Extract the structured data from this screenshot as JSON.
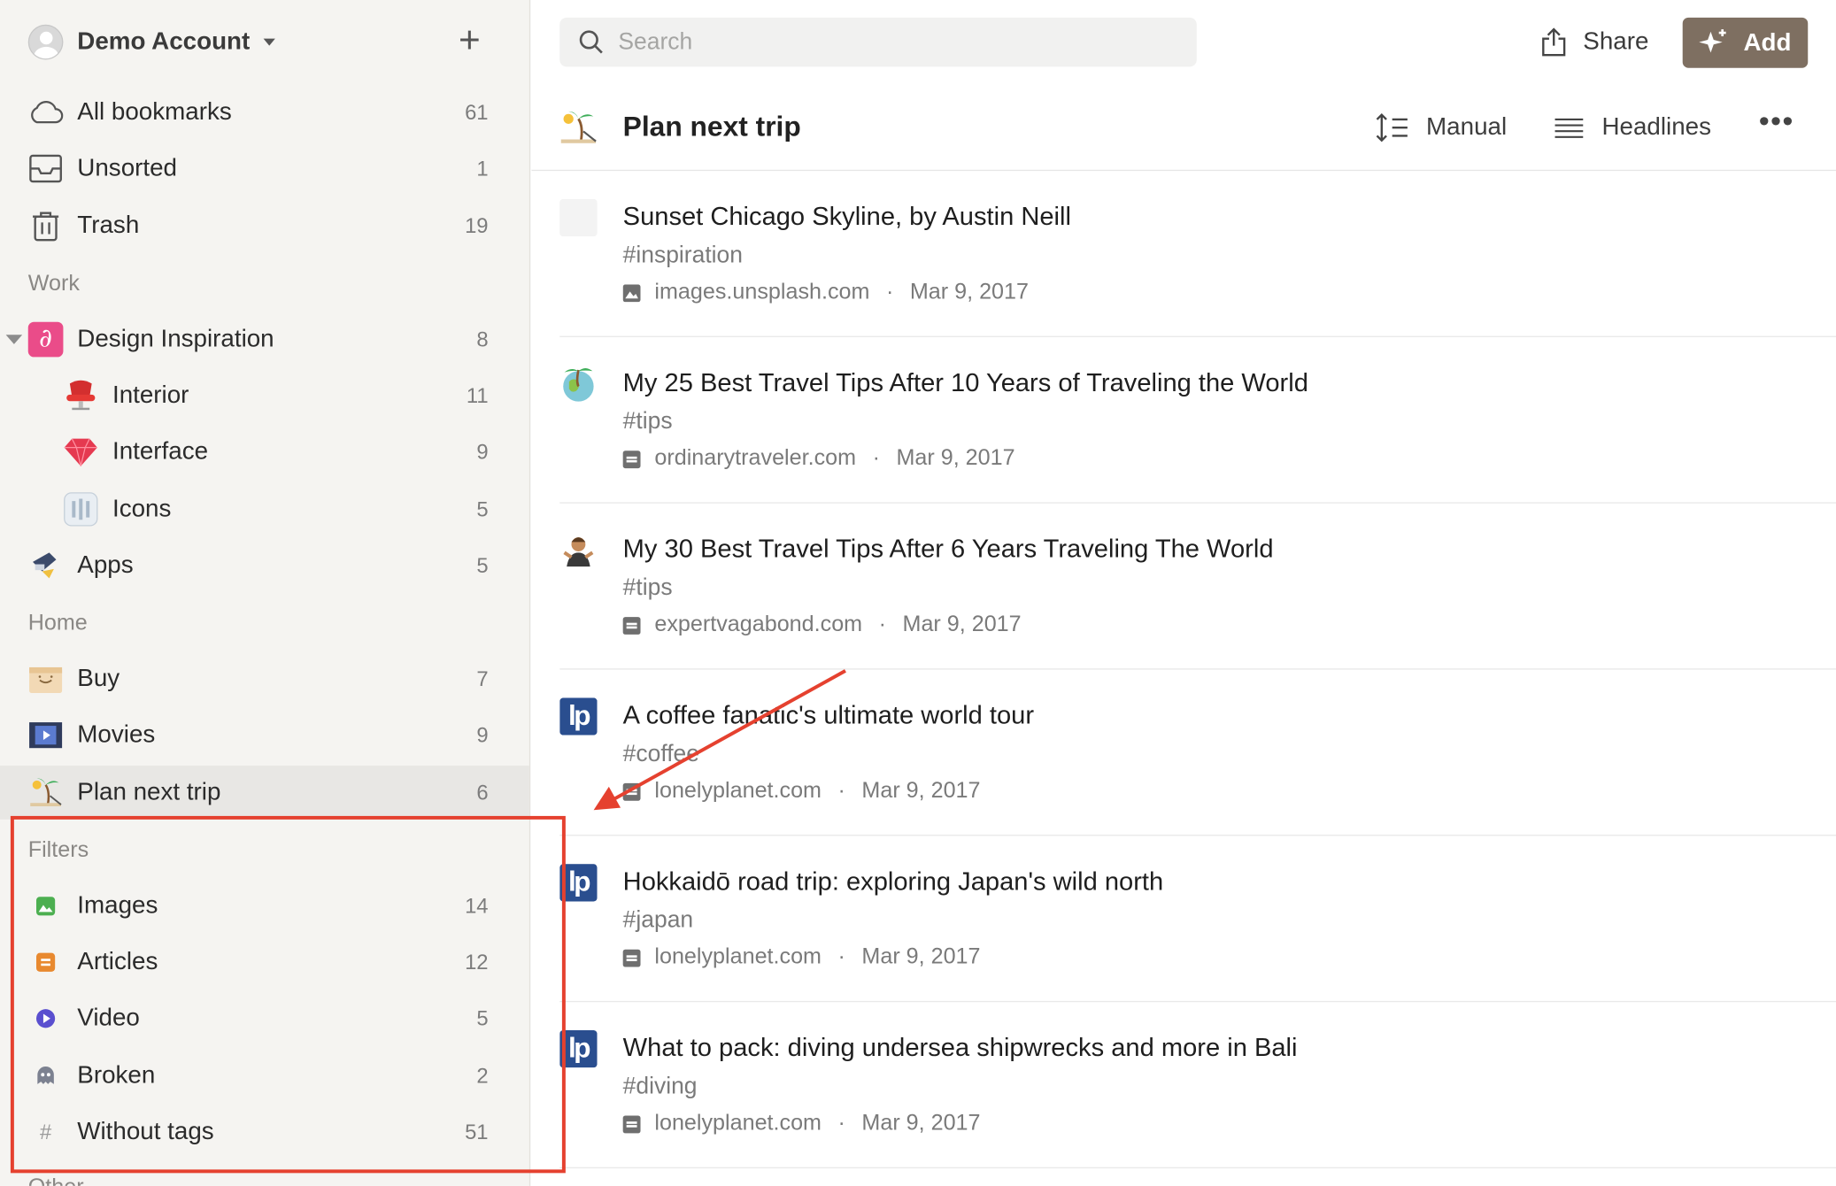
{
  "account": {
    "name": "Demo Account"
  },
  "search": {
    "placeholder": "Search"
  },
  "toolbar": {
    "share_label": "Share",
    "add_label": "Add"
  },
  "sidebar": {
    "top_items": [
      {
        "label": "All bookmarks",
        "count": "61",
        "icon": "cloud-icon"
      },
      {
        "label": "Unsorted",
        "count": "1",
        "icon": "inbox-icon"
      },
      {
        "label": "Trash",
        "count": "19",
        "icon": "trash-icon"
      }
    ],
    "sections": {
      "work": "Work",
      "home": "Home",
      "filters": "Filters",
      "other": "Other"
    },
    "work_items": [
      {
        "label": "Design Inspiration",
        "count": "8",
        "icon": "design-icon"
      },
      {
        "label": "Interior",
        "count": "11",
        "icon": "chair-icon"
      },
      {
        "label": "Interface",
        "count": "9",
        "icon": "gem-icon"
      },
      {
        "label": "Icons",
        "count": "5",
        "icon": "icons-icon"
      },
      {
        "label": "Apps",
        "count": "5",
        "icon": "apps-icon"
      }
    ],
    "home_items": [
      {
        "label": "Buy",
        "count": "7",
        "icon": "box-icon"
      },
      {
        "label": "Movies",
        "count": "9",
        "icon": "film-icon"
      },
      {
        "label": "Plan next trip",
        "count": "6",
        "icon": "beach-icon"
      }
    ],
    "filter_items": [
      {
        "label": "Images",
        "count": "14",
        "icon": "image-icon",
        "color": "#4caf50"
      },
      {
        "label": "Articles",
        "count": "12",
        "icon": "article-icon",
        "color": "#e8892f"
      },
      {
        "label": "Video",
        "count": "5",
        "icon": "play-icon",
        "color": "#5a4fcf"
      },
      {
        "label": "Broken",
        "count": "2",
        "icon": "ghost-icon",
        "color": "#7c8190"
      },
      {
        "label": "Without tags",
        "count": "51",
        "icon": "hash-icon",
        "color": "#9a9a9a"
      }
    ]
  },
  "collection": {
    "title": "Plan next trip",
    "sort_label": "Manual",
    "view_label": "Headlines"
  },
  "bookmarks": [
    {
      "title": "Sunset Chicago Skyline, by Austin Neill",
      "tag": "#inspiration",
      "domain": "images.unsplash.com",
      "date": "Mar 9, 2017",
      "type": "image",
      "thumb": "blank"
    },
    {
      "title": "My 25 Best Travel Tips After 10 Years of Traveling the World",
      "tag": "#tips",
      "domain": "ordinarytraveler.com",
      "date": "Mar 9, 2017",
      "type": "article",
      "thumb": "globe"
    },
    {
      "title": "My 30 Best Travel Tips After 6 Years Traveling The World",
      "tag": "#tips",
      "domain": "expertvagabond.com",
      "date": "Mar 9, 2017",
      "type": "article",
      "thumb": "person"
    },
    {
      "title": "A coffee fanatic's ultimate world tour",
      "tag": "#coffee",
      "domain": "lonelyplanet.com",
      "date": "Mar 9, 2017",
      "type": "article",
      "thumb": "lp"
    },
    {
      "title": "Hokkaidō road trip: exploring Japan's wild north",
      "tag": "#japan",
      "domain": "lonelyplanet.com",
      "date": "Mar 9, 2017",
      "type": "article",
      "thumb": "lp"
    },
    {
      "title": "What to pack: diving undersea shipwrecks and more in Bali",
      "tag": "#diving",
      "domain": "lonelyplanet.com",
      "date": "Mar 9, 2017",
      "type": "article",
      "thumb": "lp"
    }
  ],
  "lp_logo_text": "lp",
  "colors": {
    "accent": "#7e6f61",
    "annotation": "#e5412f",
    "selected_bg": "#e8e7e4"
  }
}
